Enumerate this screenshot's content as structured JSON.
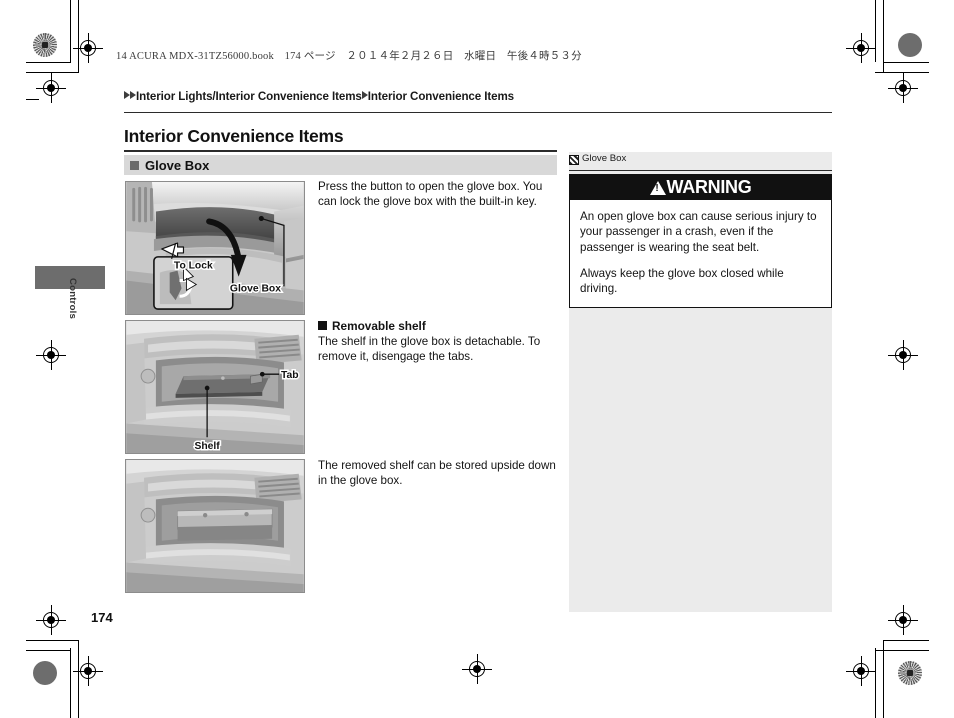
{
  "slug": {
    "text": "14 ACURA MDX-31TZ56000.book　174 ページ　２０１４年２月２６日　水曜日　午後４時５３分"
  },
  "breadcrumb": {
    "segments": [
      "Interior Lights/Interior Convenience Items",
      "Interior Convenience Items"
    ]
  },
  "page": {
    "title": "Interior Convenience Items",
    "number": "174",
    "tab_label": "Controls"
  },
  "section": {
    "heading": "Glove Box"
  },
  "body": {
    "para1": "Press the button to open the glove box. You can lock the glove box with the built-in key.",
    "subheading": "Removable shelf",
    "para2": "The shelf in the glove box is detachable. To remove it, disengage the tabs.",
    "para3": "The removed shelf can be stored upside down in the glove box."
  },
  "figures": [
    {
      "name": "glove-box-open-illustration",
      "callouts": [
        "To Lock",
        "Glove Box"
      ]
    },
    {
      "name": "removable-shelf-illustration",
      "callouts": [
        "Tab",
        "Shelf"
      ]
    },
    {
      "name": "shelf-stored-upside-down-illustration",
      "callouts": []
    }
  ],
  "sidebar": {
    "ref_label": "Glove Box",
    "warning": {
      "title": "WARNING",
      "para1": "An open glove box can cause serious injury to your passenger in a crash, even if the passenger is wearing the seat belt.",
      "para2": "Always keep the glove box closed while driving."
    }
  },
  "colors": {
    "section_bar": "#d8d8d8",
    "sidebar_bg": "#ebebeb",
    "warning_bar": "#111111",
    "tab_block": "#6d6d6d",
    "rule": "#2b2b2b"
  }
}
